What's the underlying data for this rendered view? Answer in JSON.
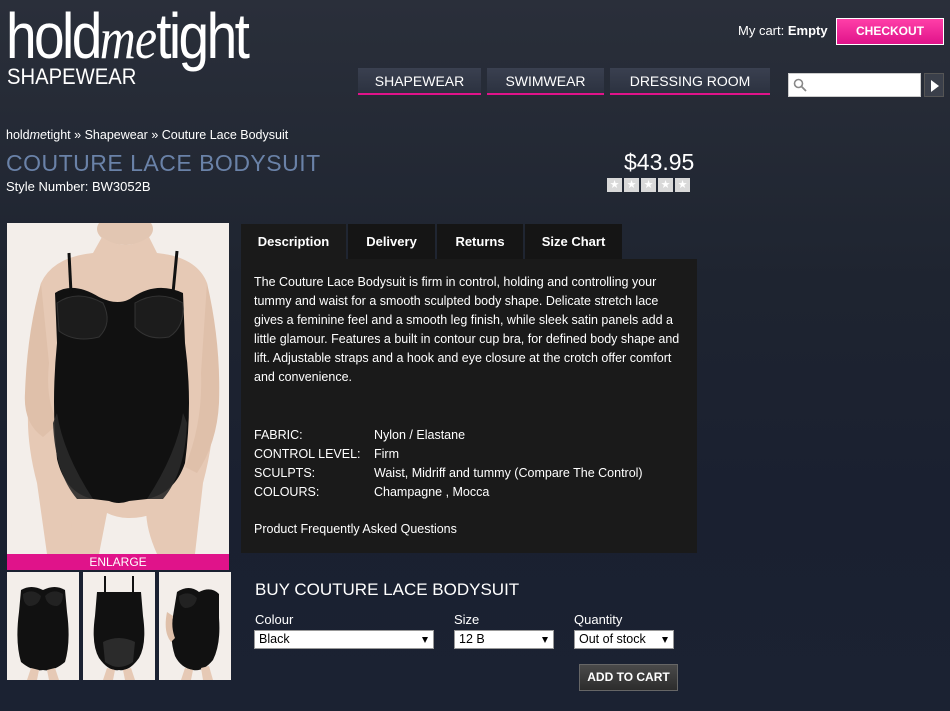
{
  "header": {
    "logo_main_pre": "hold",
    "logo_main_me": "me",
    "logo_main_post": "tight",
    "logo_sub": "SHAPEWEAR",
    "cart_label": "My cart:",
    "cart_value": "Empty",
    "checkout_label": "CHECKOUT"
  },
  "nav": {
    "items": [
      {
        "label": "SHAPEWEAR"
      },
      {
        "label": "SWIMWEAR"
      },
      {
        "label": "DRESSING ROOM"
      }
    ]
  },
  "search": {
    "placeholder": "",
    "value": ""
  },
  "breadcrumb": {
    "home_pre": "hold",
    "home_me": "me",
    "home_post": "tight",
    "sep": "»",
    "category": "Shapewear",
    "current": "Couture Lace Bodysuit"
  },
  "product": {
    "title": "COUTURE LACE BODYSUIT",
    "style_number": "Style Number: BW3052B",
    "price": "$43.95",
    "rating_stars": 5,
    "rating_value": 0,
    "enlarge_label": "ENLARGE"
  },
  "tabs": [
    {
      "label": "Description"
    },
    {
      "label": "Delivery"
    },
    {
      "label": "Returns"
    },
    {
      "label": "Size Chart"
    }
  ],
  "description": {
    "text": "The Couture Lace Bodysuit is firm in control, holding and controlling your tummy and waist for a smooth sculpted body shape. Delicate stretch lace gives a feminine feel and a smooth leg finish, while sleek satin panels add a little glamour. Features a built in contour cup bra, for defined body shape and lift. Adjustable straps and a hook and eye closure at the crotch offer comfort and convenience.",
    "specs": [
      {
        "label": "FABRIC:",
        "value": "Nylon / Elastane"
      },
      {
        "label": "CONTROL LEVEL:",
        "value": "Firm"
      },
      {
        "label": "SCULPTS:",
        "value": "Waist, Midriff and tummy (Compare The Control)"
      },
      {
        "label": "COLOURS:",
        "value": "Champagne , Mocca"
      }
    ],
    "faq_label": "Product Frequently Asked Questions"
  },
  "buy": {
    "title": "BUY COUTURE LACE BODYSUIT",
    "colour_label": "Colour",
    "colour_value": "Black",
    "size_label": "Size",
    "size_value": "12 B",
    "quantity_label": "Quantity",
    "quantity_value": "Out of stock",
    "add_to_cart_label": "ADD TO CART"
  },
  "colors": {
    "accent": "#e0138a",
    "title": "#6a82a8",
    "panel": "#1a1a1a"
  }
}
